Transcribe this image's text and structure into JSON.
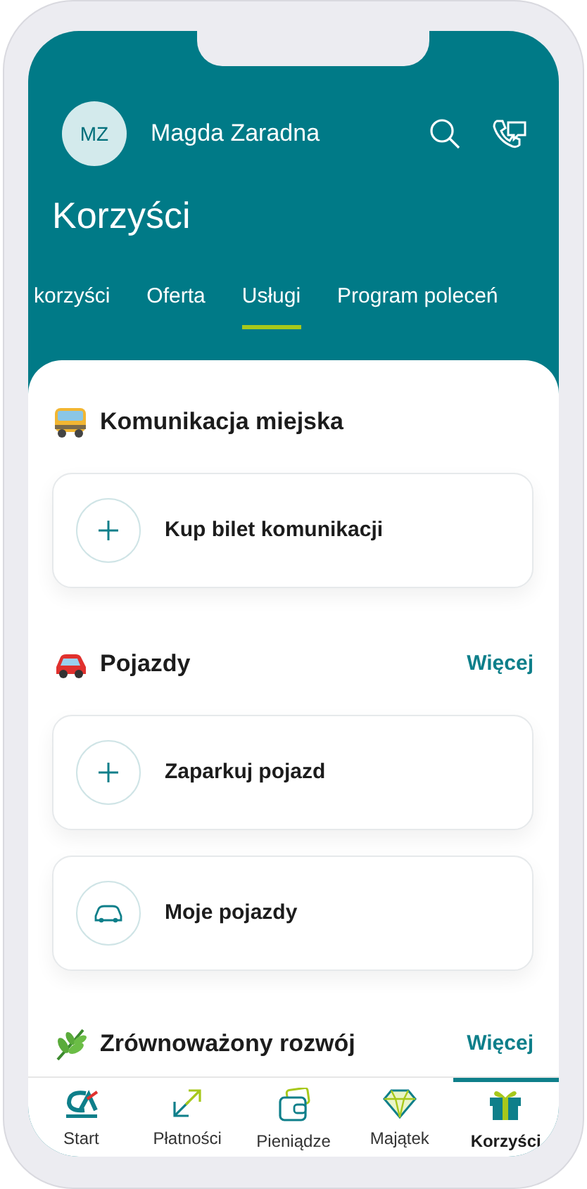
{
  "header": {
    "avatar_initials": "MZ",
    "user_name": "Magda Zaradna"
  },
  "title": "Korzyści",
  "tabs": [
    {
      "label": "korzyści",
      "selected": false
    },
    {
      "label": "Oferta",
      "selected": false
    },
    {
      "label": "Usługi",
      "selected": true
    },
    {
      "label": "Program poleceń",
      "selected": false
    }
  ],
  "sections": [
    {
      "title": "Komunikacja miejska",
      "kind": "bus",
      "items": [
        {
          "label": "Kup bilet komunikacji",
          "kind": "add"
        }
      ]
    },
    {
      "title": "Pojazdy",
      "kind": "car",
      "more": "Więcej",
      "items": [
        {
          "label": "Zaparkuj pojazd",
          "kind": "add"
        },
        {
          "label": "Moje pojazdy",
          "kind": "vehicle"
        }
      ]
    },
    {
      "title": "Zrównoważony rozwój",
      "kind": "leaf",
      "more": "Więcej"
    }
  ],
  "nav": [
    {
      "label": "Start",
      "kind": "home",
      "selected": false
    },
    {
      "label": "Płatności",
      "kind": "payments",
      "selected": false
    },
    {
      "label": "Pieniądze",
      "kind": "wallet",
      "selected": false
    },
    {
      "label": "Majątek",
      "kind": "diamond",
      "selected": false
    },
    {
      "label": "Korzyści",
      "kind": "gift",
      "selected": true
    }
  ]
}
